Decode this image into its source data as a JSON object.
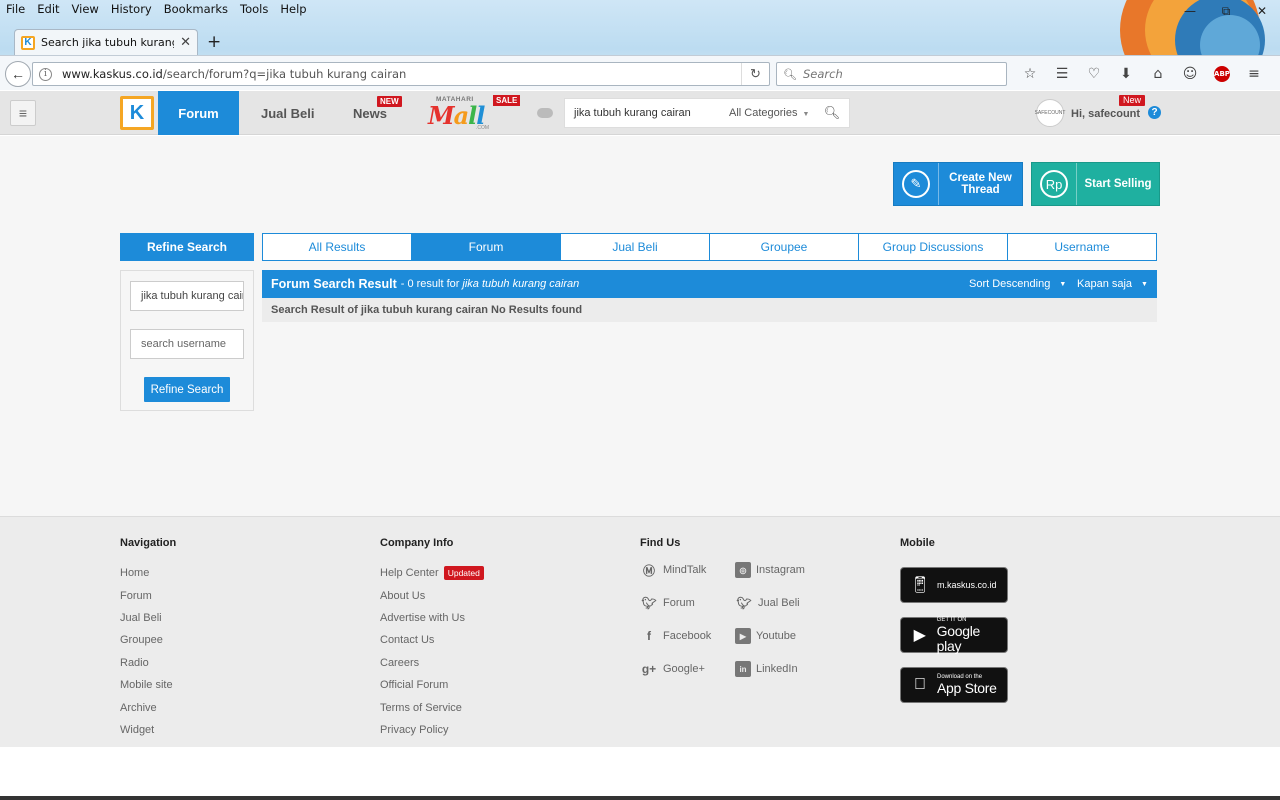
{
  "browser": {
    "menu": [
      "File",
      "Edit",
      "View",
      "History",
      "Bookmarks",
      "Tools",
      "Help"
    ],
    "tab_title": "Search jika tubuh kurang ...",
    "url_host": "www.kaskus.co.id",
    "url_path": "/search/forum?q=jika tubuh kurang cairan",
    "search_placeholder": "Search",
    "abp_label": "ABP"
  },
  "header": {
    "nav": {
      "forum": "Forum",
      "jual_beli": "Jual Beli",
      "news": "News",
      "news_badge": "NEW",
      "mall_top": "MATAHARI",
      "mall_letters": [
        "M",
        "a",
        "l",
        "l"
      ],
      "mall_com": ".COM",
      "mall_badge": "SALE"
    },
    "search": {
      "query": "jika tubuh kurang cairan",
      "category": "All Categories"
    },
    "user": {
      "greeting": "Hi, safecount",
      "badge": "New",
      "avatar_text": "SAFECOUNT"
    }
  },
  "actions": {
    "create_thread": "Create New Thread",
    "start_selling": "Start Selling",
    "rp_symbol": "Rp"
  },
  "refine": {
    "header": "Refine Search",
    "query_value": "jika tubuh kurang cairan",
    "username_placeholder": "search username",
    "button": "Refine Search"
  },
  "tabs": [
    "All Results",
    "Forum",
    "Jual Beli",
    "Groupee",
    "Group Discussions",
    "Username"
  ],
  "results": {
    "title": "Forum Search Result",
    "count_text": "- 0 result for",
    "query": "jika tubuh kurang cairan",
    "sort": "Sort Descending",
    "time": "Kapan saja",
    "message": "Search Result of jika tubuh kurang cairan No Results found"
  },
  "footer": {
    "navigation": {
      "title": "Navigation",
      "links": [
        "Home",
        "Forum",
        "Jual Beli",
        "Groupee",
        "Radio",
        "Mobile site",
        "Archive",
        "Widget"
      ]
    },
    "company": {
      "title": "Company Info",
      "links": [
        "Help Center",
        "About Us",
        "Advertise with Us",
        "Contact Us",
        "Careers",
        "Official Forum",
        "Terms of Service",
        "Privacy Policy"
      ],
      "updated_badge": "Updated"
    },
    "find_us": {
      "title": "Find Us",
      "items": [
        {
          "label": "MindTalk",
          "icon": "mindtalk-icon"
        },
        {
          "label": "Instagram",
          "icon": "instagram-icon"
        },
        {
          "label": "Forum",
          "icon": "twitter-icon"
        },
        {
          "label": "Jual Beli",
          "icon": "twitter-icon"
        },
        {
          "label": "Facebook",
          "icon": "facebook-icon"
        },
        {
          "label": "Youtube",
          "icon": "youtube-icon"
        },
        {
          "label": "Google+",
          "icon": "google-plus-icon"
        },
        {
          "label": "LinkedIn",
          "icon": "linkedin-icon"
        }
      ]
    },
    "mobile": {
      "title": "Mobile",
      "site": "m.kaskus.co.id",
      "gplay_small": "GET IT ON",
      "gplay_big": "Google play",
      "appstore_small": "Download on the",
      "appstore_big": "App Store"
    }
  },
  "colors": {
    "accent": "#1d8bd9",
    "sell": "#1fb0a0",
    "badge": "#d0171f",
    "logo_border": "#f5a623"
  }
}
